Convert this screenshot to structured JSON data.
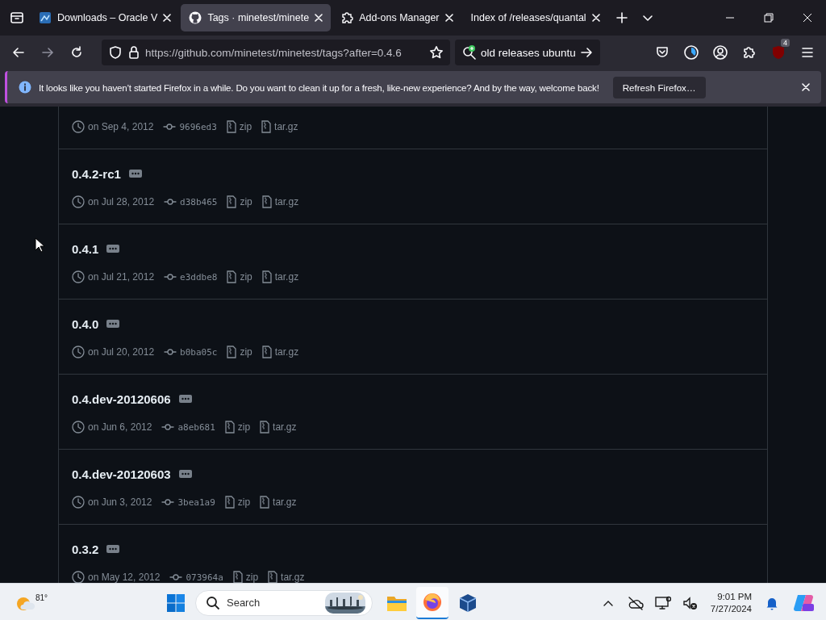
{
  "tabs": [
    {
      "title": "Downloads – Oracle V",
      "selected": false
    },
    {
      "title": "Tags · minetest/minete",
      "selected": true
    },
    {
      "title": "Add-ons Manager",
      "selected": false
    },
    {
      "title": "Index of /releases/quantal",
      "selected": false
    }
  ],
  "url": "https://github.com/minetest/minetest/tags?after=0.4.6",
  "search": {
    "value": "old releases ubuntu"
  },
  "extension_badge": "4",
  "notification": {
    "message": "It looks like you haven’t started Firefox in a while. Do you want to clean it up for a fresh, like-new experience? And by the way, welcome back!",
    "button": "Refresh Firefox…"
  },
  "tags": [
    {
      "date": "on Sep 4, 2012",
      "commit": "9696ed3",
      "zip": "zip",
      "targz": "tar.gz"
    },
    {
      "name": "0.4.2-rc1",
      "date": "on Jul 28, 2012",
      "commit": "d38b465",
      "zip": "zip",
      "targz": "tar.gz"
    },
    {
      "name": "0.4.1",
      "date": "on Jul 21, 2012",
      "commit": "e3ddbe8",
      "zip": "zip",
      "targz": "tar.gz"
    },
    {
      "name": "0.4.0",
      "date": "on Jul 20, 2012",
      "commit": "b0ba05c",
      "zip": "zip",
      "targz": "tar.gz"
    },
    {
      "name": "0.4.dev-20120606",
      "date": "on Jun 6, 2012",
      "commit": "a8eb681",
      "zip": "zip",
      "targz": "tar.gz"
    },
    {
      "name": "0.4.dev-20120603",
      "date": "on Jun 3, 2012",
      "commit": "3bea1a9",
      "zip": "zip",
      "targz": "tar.gz"
    },
    {
      "name": "0.3.2",
      "date": "on May 12, 2012",
      "commit": "073964a",
      "zip": "zip",
      "targz": "tar.gz"
    }
  ],
  "taskbar": {
    "temperature": "81°",
    "search_placeholder": "Search",
    "time": "9:01 PM",
    "date": "7/27/2024"
  }
}
